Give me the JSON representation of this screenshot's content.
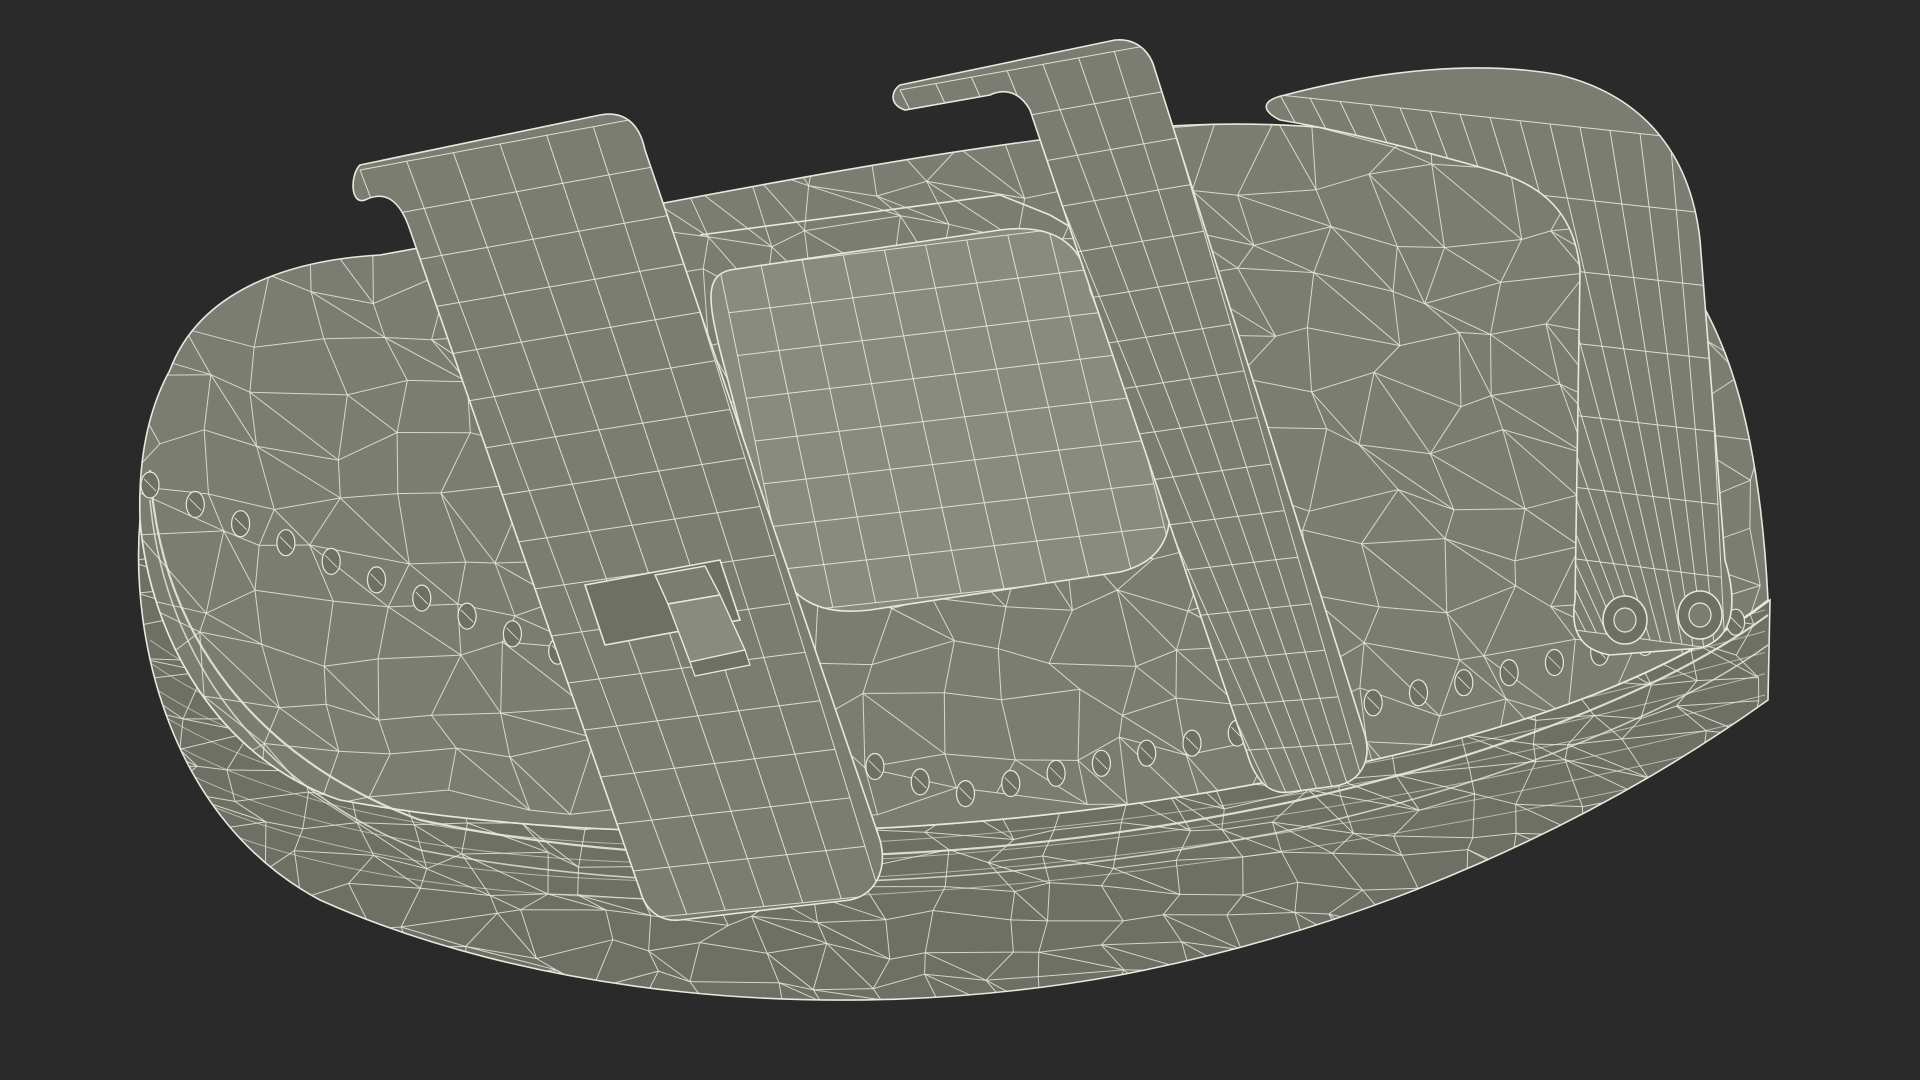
{
  "scene": {
    "background_color": "#2a2a2a",
    "surface_color": "#7c7d72",
    "surface_shadow_color": "#6e6f65",
    "surface_highlight_color": "#8a8b80",
    "wire_color": "#e8e8dc",
    "subject": "wireframe-3d-kick-pad"
  }
}
